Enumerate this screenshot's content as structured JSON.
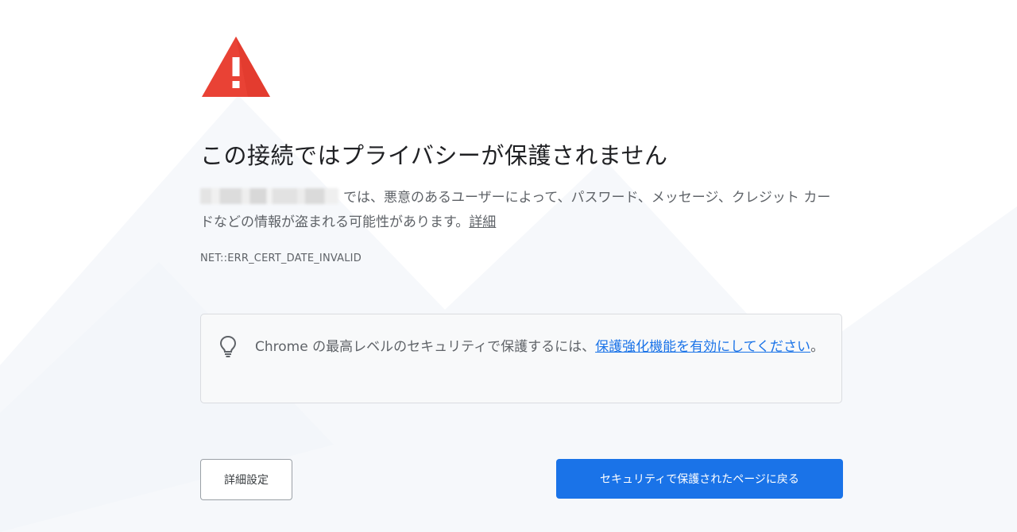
{
  "page": {
    "title": "この接続ではプライバシーが保護されません",
    "message": {
      "text": "では、悪意のあるユーザーによって、パスワード、メッセージ、クレジット カードなどの情報が盗まれる可能性があります。",
      "details_link": "詳細"
    },
    "error_code": "NET::ERR_CERT_DATE_INVALID",
    "enhanced_protection": {
      "text_before": "Chrome の最高レベルのセキュリティで保護するには、",
      "link": "保護強化機能を有効にしてください",
      "text_after": "。"
    },
    "buttons": {
      "advanced": "詳細設定",
      "back_to_safety": "セキュリティで保護されたページに戻る"
    }
  },
  "icons": {
    "warning": "warning-triangle-icon",
    "bulb": "lightbulb-icon"
  },
  "colors": {
    "warning_red": "#e94235",
    "primary_blue": "#1a73e8",
    "text_primary": "#202124",
    "text_secondary": "#5f6368",
    "box_background": "#f8f9fa",
    "box_border": "#dadce0"
  }
}
